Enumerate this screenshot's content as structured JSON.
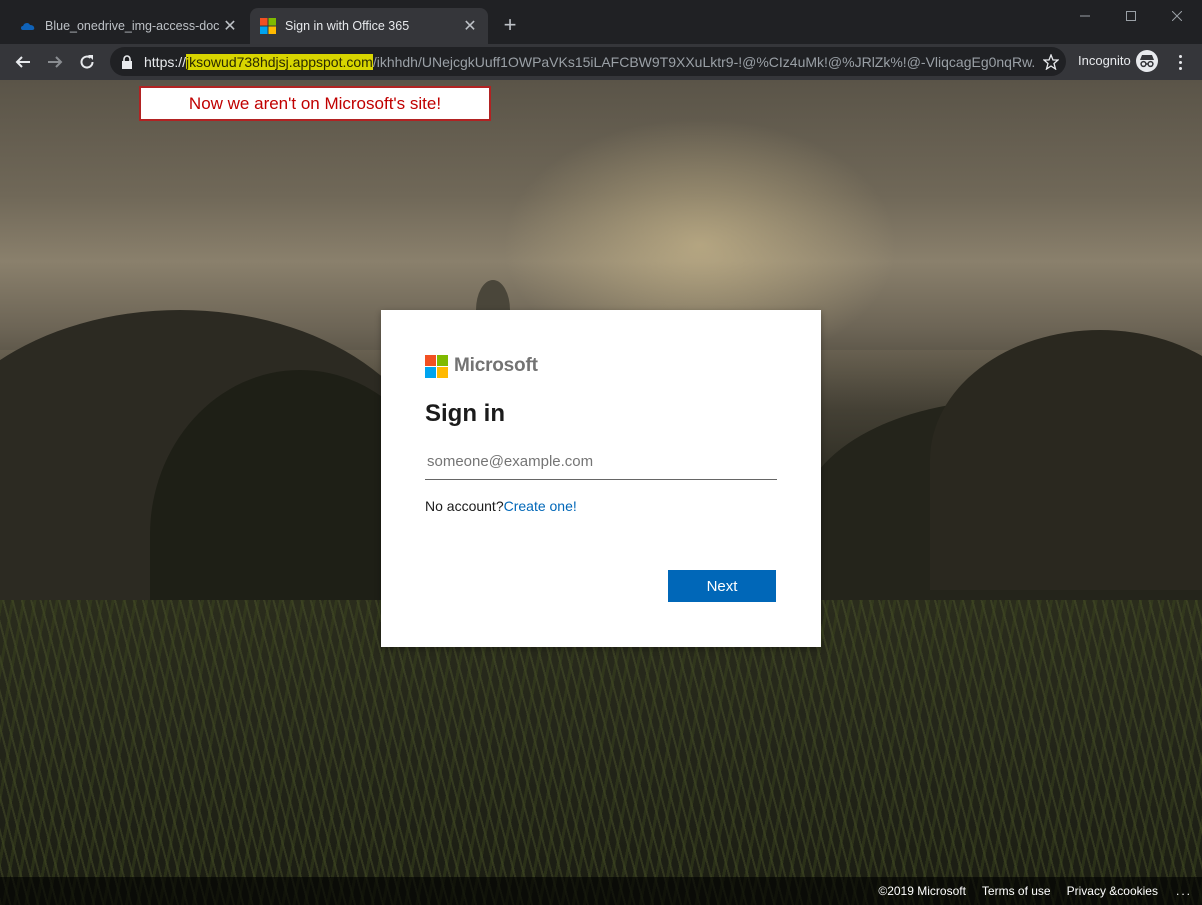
{
  "browser": {
    "tabs": [
      {
        "title": "Blue_onedrive_img-access-docur",
        "icon": "onedrive-cloud-icon",
        "active": false
      },
      {
        "title": "Sign in with Office 365",
        "icon": "microsoft-logo-icon",
        "active": true
      }
    ],
    "new_tab_symbol": "+",
    "url": {
      "scheme": "https://",
      "host": "jksowud738hdjsj.appspot.com",
      "path": "/ikhhdh/UNejcgkUuff1OWPaVKs15iLAFCBW9T9XXuLktr9-!@%CIz4uMk!@%JRlZk%!@-VliqcagEg0nqRw..."
    },
    "incognito_label": "Incognito",
    "accent_highlight": "#d8d500"
  },
  "annotation": {
    "text": "Now we aren't on Microsoft's site!",
    "color": "#c00000"
  },
  "signin": {
    "brand": "Microsoft",
    "title": "Sign in",
    "email_placeholder": "someone@example.com",
    "no_account_text": "No account?",
    "create_link": "Create one!",
    "next_label": "Next",
    "button_color": "#0067b8"
  },
  "footer": {
    "copyright": "©2019 Microsoft",
    "terms": "Terms of use",
    "privacy": "Privacy &cookies",
    "more": "..."
  }
}
